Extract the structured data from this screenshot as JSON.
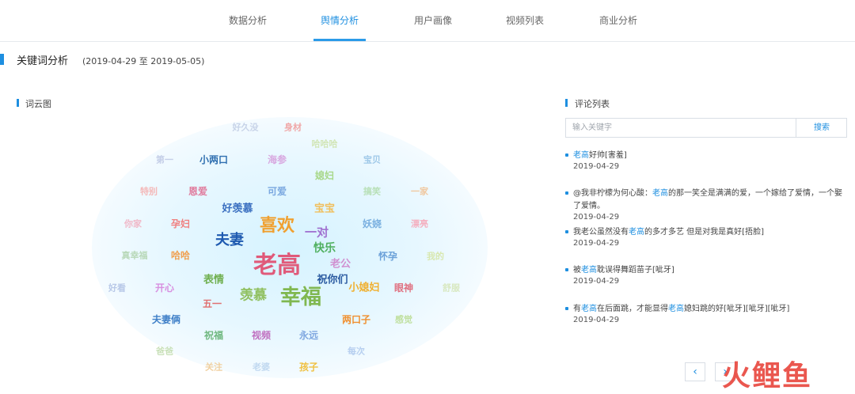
{
  "nav": {
    "tabs": [
      {
        "label": "数据分析"
      },
      {
        "label": "舆情分析"
      },
      {
        "label": "用户画像"
      },
      {
        "label": "视频列表"
      },
      {
        "label": "商业分析"
      }
    ],
    "active_tab": "舆情分析"
  },
  "page": {
    "title": "关键词分析",
    "date_range": "(2019-04-29 至 2019-05-05)"
  },
  "wordcloud": {
    "section_title": "词云图",
    "words": [
      {
        "text": "好久没",
        "color": "#c7d3e8"
      },
      {
        "text": "身材",
        "color": "#f0a8a8"
      },
      {
        "text": "哈哈哈",
        "color": "#d2e6b8"
      },
      {
        "text": "第一",
        "color": "#c5cfe8"
      },
      {
        "text": "小两口",
        "color": "#2f6fb0"
      },
      {
        "text": "海参",
        "color": "#d8a8e0"
      },
      {
        "text": "宝贝",
        "color": "#9ec8e8"
      },
      {
        "text": "媳妇",
        "color": "#a8d88a"
      },
      {
        "text": "特别",
        "color": "#f4b8b8"
      },
      {
        "text": "恩爱",
        "color": "#e07a9c"
      },
      {
        "text": "可爱",
        "color": "#7aa8e0"
      },
      {
        "text": "搞笑",
        "color": "#b8e0b8"
      },
      {
        "text": "一家",
        "color": "#f0c8a0"
      },
      {
        "text": "好羡慕",
        "color": "#3a6fc0"
      },
      {
        "text": "宝宝",
        "color": "#f0c060"
      },
      {
        "text": "喜欢",
        "color": "#f0a030"
      },
      {
        "text": "你家",
        "color": "#f0b8c8"
      },
      {
        "text": "孕妇",
        "color": "#f08080"
      },
      {
        "text": "妖娆",
        "color": "#7ab0e0"
      },
      {
        "text": "漂亮",
        "color": "#f4b0c0"
      },
      {
        "text": "一对",
        "color": "#a070d0"
      },
      {
        "text": "夫妻",
        "color": "#1e5ab0"
      },
      {
        "text": "快乐",
        "color": "#50b060"
      },
      {
        "text": "真幸福",
        "color": "#b8d8b8"
      },
      {
        "text": "哈哈",
        "color": "#f0a050"
      },
      {
        "text": "老高",
        "color": "#e05a7a"
      },
      {
        "text": "老公",
        "color": "#d090d0"
      },
      {
        "text": "怀孕",
        "color": "#6aa0d8"
      },
      {
        "text": "我的",
        "color": "#d8e8b0"
      },
      {
        "text": "表情",
        "color": "#70b050"
      },
      {
        "text": "祝你们",
        "color": "#2a5aa0"
      },
      {
        "text": "好看",
        "color": "#b8c8e8"
      },
      {
        "text": "开心",
        "color": "#d890e0"
      },
      {
        "text": "小媳妇",
        "color": "#f0b030"
      },
      {
        "text": "眼神",
        "color": "#e07080"
      },
      {
        "text": "舒服",
        "color": "#d8e8c0"
      },
      {
        "text": "羡慕",
        "color": "#90c060"
      },
      {
        "text": "幸福",
        "color": "#80b850"
      },
      {
        "text": "五一",
        "color": "#e07070"
      },
      {
        "text": "夫妻俩",
        "color": "#4080c8"
      },
      {
        "text": "两口子",
        "color": "#f09030"
      },
      {
        "text": "感觉",
        "color": "#c0e0a0"
      },
      {
        "text": "祝福",
        "color": "#70b880"
      },
      {
        "text": "视频",
        "color": "#c070c0"
      },
      {
        "text": "永远",
        "color": "#80a8e0"
      },
      {
        "text": "每次",
        "color": "#b8d0f0"
      },
      {
        "text": "爸爸",
        "color": "#c8e0b8"
      },
      {
        "text": "关注",
        "color": "#f0d0a0"
      },
      {
        "text": "老婆",
        "color": "#c0d8f0"
      },
      {
        "text": "孩子",
        "color": "#f0c040"
      }
    ]
  },
  "comments": {
    "section_title": "评论列表",
    "search_placeholder": "输入关键字",
    "search_button": "搜索",
    "items": [
      {
        "parts": [
          {
            "t": "老高",
            "hl": true
          },
          {
            "t": "好帅[害羞]",
            "hl": false
          }
        ],
        "date": "2019-04-29"
      },
      {
        "parts": [
          {
            "t": "@我非柠檬为何心酸：",
            "hl": false
          },
          {
            "t": "老高",
            "hl": true
          },
          {
            "t": "的那一笑全是满满的爱，一个嫁给了爱情，一个娶了爱情。",
            "hl": false
          }
        ],
        "date": "2019-04-29"
      },
      {
        "parts": [
          {
            "t": "我老公虽然没有",
            "hl": false
          },
          {
            "t": "老高",
            "hl": true
          },
          {
            "t": "的多才多艺 但是对我是真好[捂脸]",
            "hl": false
          }
        ],
        "date": "2019-04-29"
      },
      {
        "parts": [
          {
            "t": "被",
            "hl": false
          },
          {
            "t": "老高",
            "hl": true
          },
          {
            "t": "耽误得舞蹈苗子[呲牙]",
            "hl": false
          }
        ],
        "date": "2019-04-29"
      },
      {
        "parts": [
          {
            "t": "有",
            "hl": false
          },
          {
            "t": "老高",
            "hl": true
          },
          {
            "t": "在后面跳，才能显得",
            "hl": false
          },
          {
            "t": "老高",
            "hl": true
          },
          {
            "t": "媳妇跳的好[呲牙][呲牙][呲牙]",
            "hl": false
          }
        ],
        "date": "2019-04-29"
      }
    ],
    "pager_prev": "‹",
    "pager_next": "›"
  },
  "watermark": {
    "text": "火鲤鱼"
  }
}
